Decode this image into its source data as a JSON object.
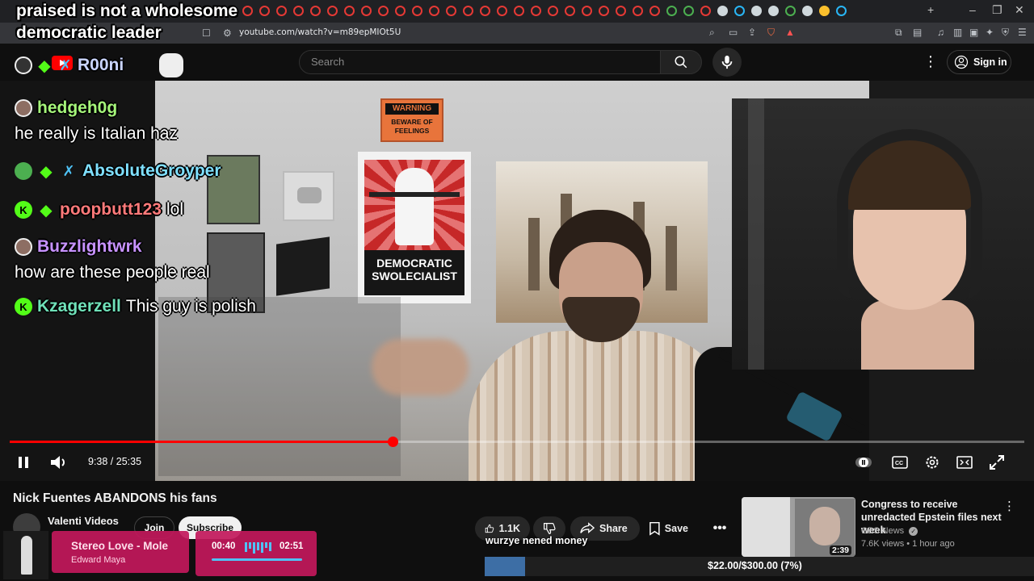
{
  "overlay": {
    "headline_line1": "praised is not a wholesome",
    "headline_line2": "democratic leader"
  },
  "browser": {
    "url": "youtube.com/watch?v=m89epMIOt5U"
  },
  "youtube_header": {
    "logo_text": "YouTube",
    "search_placeholder": "Search",
    "sign_in_label": "Sign in"
  },
  "chat": [
    {
      "badges": [
        "avatar"
      ],
      "name": "",
      "name_color": "#c9d4ff",
      "message": ""
    },
    {
      "badges": [
        "avatar"
      ],
      "name": "hedgeh0g",
      "name_color": "#a5f57a",
      "message": ""
    },
    {
      "badges": [],
      "name": "",
      "name_color": "#ffffff",
      "message": "he really is Italian haz"
    },
    {
      "badges": [
        "frog",
        "diamond",
        "sword"
      ],
      "name": "AbsoluteGroyper",
      "name_color": "#7fe0ff",
      "message": ""
    },
    {
      "badges": [
        "k",
        "diamond"
      ],
      "name": "poopbutt123",
      "name_color": "#ff7a7a",
      "message": "lol"
    },
    {
      "badges": [
        "avatar"
      ],
      "name": "Buzzlightwrk",
      "name_color": "#c792ff",
      "message": ""
    },
    {
      "badges": [],
      "name": "",
      "name_color": "#ffffff",
      "message": "how are these people real"
    },
    {
      "badges": [
        "k"
      ],
      "name": "Kzagerzell",
      "name_color": "#6fe0b8",
      "message": "This guy is polish"
    }
  ],
  "chat_top": {
    "name": "R00ni",
    "name_color": "#c9d4ff"
  },
  "poster": {
    "warning_title": "WARNING",
    "warning_body": "BEWARE OF FEELINGS",
    "poster_text": "DEMOCRATIC SWOLECIALIST"
  },
  "player": {
    "current_time": "9:38",
    "duration": "25:35",
    "timecode": "9:38 / 25:35",
    "progress_fraction": 0.377,
    "played_color": "#ff0000"
  },
  "video": {
    "title": "Nick Fuentes ABANDONS his fans",
    "channel": "Valenti Videos",
    "join_label": "Join",
    "subscribe_label": "Subscribe",
    "likes": "1.1K",
    "share_label": "Share",
    "save_label": "Save"
  },
  "music_widget": {
    "song": "Stereo Love - Mole",
    "artist": "Edward Maya",
    "elapsed": "00:40",
    "total": "02:51",
    "accent_color": "#c2185b"
  },
  "donation": {
    "ticker_text": "wurzye nened money",
    "goal_text": "$22.00/$300.00 (7%)",
    "goal_fraction": 0.073,
    "fill_color": "#3d6ea5"
  },
  "recommended": {
    "title": "Congress to receive unredacted Epstein files next week",
    "channel": "CBS News",
    "views": "7.6K views",
    "age": "1 hour ago",
    "meta": "7.6K views • 1 hour ago",
    "duration": "2:39"
  }
}
